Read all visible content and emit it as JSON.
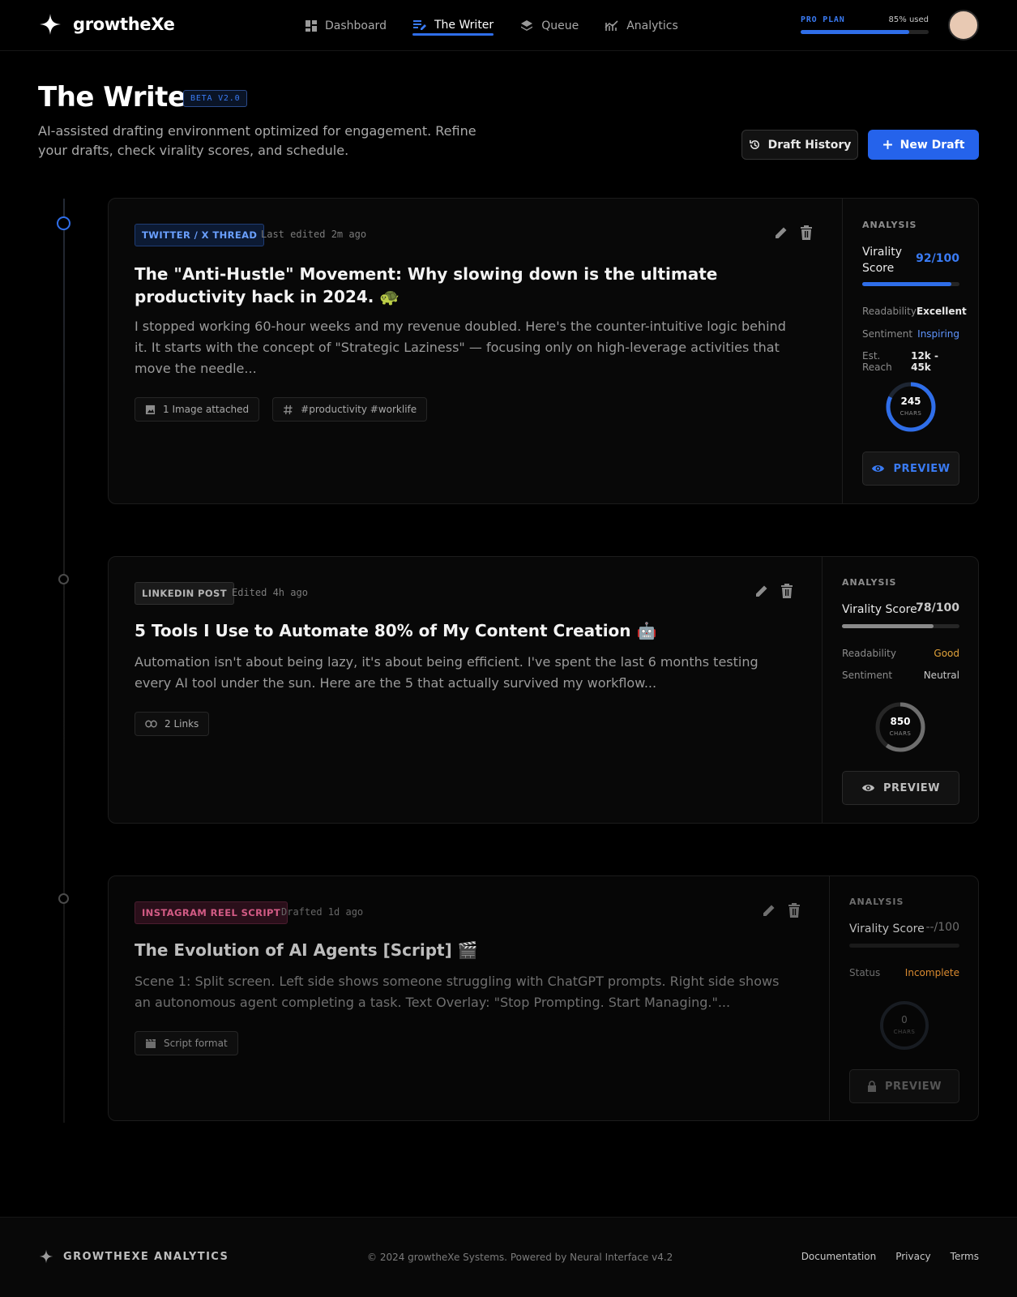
{
  "app": {
    "name": "growtheXe"
  },
  "nav": {
    "items": [
      {
        "label": "Dashboard",
        "icon": "dashboard-icon",
        "active": false
      },
      {
        "label": "The Writer",
        "icon": "writer-icon",
        "active": true
      },
      {
        "label": "Queue",
        "icon": "layers-icon",
        "active": false
      },
      {
        "label": "Analytics",
        "icon": "chart-icon",
        "active": false
      }
    ]
  },
  "plan": {
    "name": "PRO PLAN",
    "usage_label": "85% used",
    "usage": 0.85
  },
  "header": {
    "title": "The Writer",
    "badge": "BETA V2.0",
    "subtitle": "AI-assisted drafting environment optimized for engagement. Refine your drafts, check virality scores, and schedule.",
    "history_button": "Draft History",
    "new_button": "New Draft"
  },
  "drafts": [
    {
      "platform": "TWITTER / X THREAD",
      "edited": "Last edited 2m ago",
      "title": "The \"Anti-Hustle\" Movement: Why slowing down is the ultimate productivity hack in 2024. 🐢",
      "body": "I stopped working 60-hour weeks and my revenue doubled. Here's the counter-intuitive logic behind it. It starts with the concept of \"Strategic Laziness\" — focusing only on high-leverage activities that move the needle...",
      "chips": [
        {
          "icon": "image-icon",
          "label": "1 Image attached"
        },
        {
          "icon": "hashtag-icon",
          "label": "#productivity #worklife"
        }
      ],
      "analysis": {
        "label": "ANALYSIS",
        "virality_label": "Virality Score",
        "virality_value": "92/100",
        "virality": 0.92,
        "metrics": [
          {
            "key": "Readability",
            "value": "Excellent",
            "color": "#e8e8e8"
          },
          {
            "key": "Sentiment",
            "value": "Inspiring",
            "color": "#5f95ff"
          },
          {
            "key": "Est. Reach",
            "value": "12k - 45k",
            "color": "#e8e8e8"
          }
        ],
        "chars": "245",
        "chars_unit": "CHARS",
        "ring_fill": 0.82,
        "preview": "PREVIEW"
      }
    },
    {
      "platform": "LINKEDIN POST",
      "edited": "Edited 4h ago",
      "title": "5 Tools I Use to Automate 80% of My Content Creation 🤖",
      "body": "Automation isn't about being lazy, it's about being efficient. I've spent the last 6 months testing every AI tool under the sun. Here are the 5 that actually survived my workflow...",
      "chips": [
        {
          "icon": "link-icon",
          "label": "2 Links"
        }
      ],
      "analysis": {
        "label": "ANALYSIS",
        "virality_label": "Virality Score",
        "virality_value": "78/100",
        "virality": 0.78,
        "metrics": [
          {
            "key": "Readability",
            "value": "Good",
            "color": "#e0a23a"
          },
          {
            "key": "Sentiment",
            "value": "Neutral",
            "color": "#c9c9c9"
          }
        ],
        "chars": "850",
        "chars_unit": "CHARS",
        "ring_fill": 0.6,
        "preview": "PREVIEW"
      }
    },
    {
      "platform": "INSTAGRAM REEL SCRIPT",
      "edited": "Drafted 1d ago",
      "title": "The Evolution of AI Agents [Script] 🎬",
      "body": "Scene 1: Split screen. Left side shows someone struggling with ChatGPT prompts. Right side shows an autonomous agent completing a task. Text Overlay: \"Stop Prompting. Start Managing.\"...",
      "chips": [
        {
          "icon": "clapper-icon",
          "label": "Script format"
        }
      ],
      "analysis": {
        "label": "ANALYSIS",
        "virality_label": "Virality Score",
        "virality_value": "--/100",
        "virality": 0,
        "metrics": [
          {
            "key": "Status",
            "value": "Incomplete",
            "color": "#d98a2f"
          }
        ],
        "chars": "0",
        "chars_unit": "CHARS",
        "ring_fill": 0,
        "preview": "PREVIEW"
      }
    }
  ],
  "footer": {
    "brand": "GROWTHEXE ANALYTICS",
    "copyright": "© 2024 growtheXe Systems. Powered by Neural Interface v4.2",
    "links": [
      "Documentation",
      "Privacy",
      "Terms"
    ]
  },
  "colors": {
    "accent": "#2563eb",
    "background": "#000000"
  }
}
